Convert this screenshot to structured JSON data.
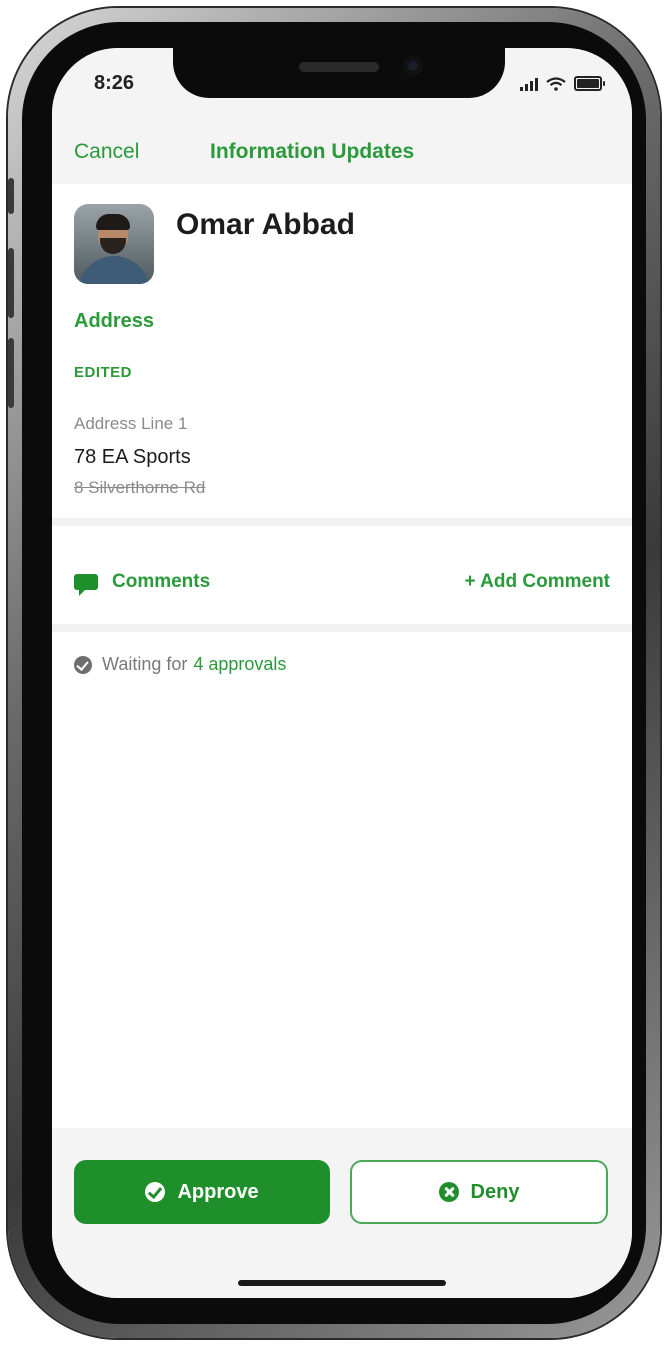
{
  "status_bar": {
    "time": "8:26"
  },
  "nav": {
    "cancel_label": "Cancel",
    "title": "Information Updates"
  },
  "profile": {
    "name": "Omar Abbad"
  },
  "section": {
    "title": "Address",
    "status": "EDITED",
    "field_label": "Address Line 1",
    "new_value": "78 EA Sports",
    "old_value": "8 Silverthorne Rd"
  },
  "comments": {
    "label": "Comments",
    "add_label": "+ Add Comment"
  },
  "approvals": {
    "prefix": "Waiting for",
    "count_text": "4 approvals"
  },
  "actions": {
    "approve_label": "Approve",
    "deny_label": "Deny"
  },
  "colors": {
    "accent": "#2a9a3a",
    "button_green": "#1f8f2c"
  },
  "icons": [
    "signal-icon",
    "wifi-icon",
    "battery-icon",
    "comment-icon",
    "check-circle-icon",
    "x-circle-icon"
  ]
}
